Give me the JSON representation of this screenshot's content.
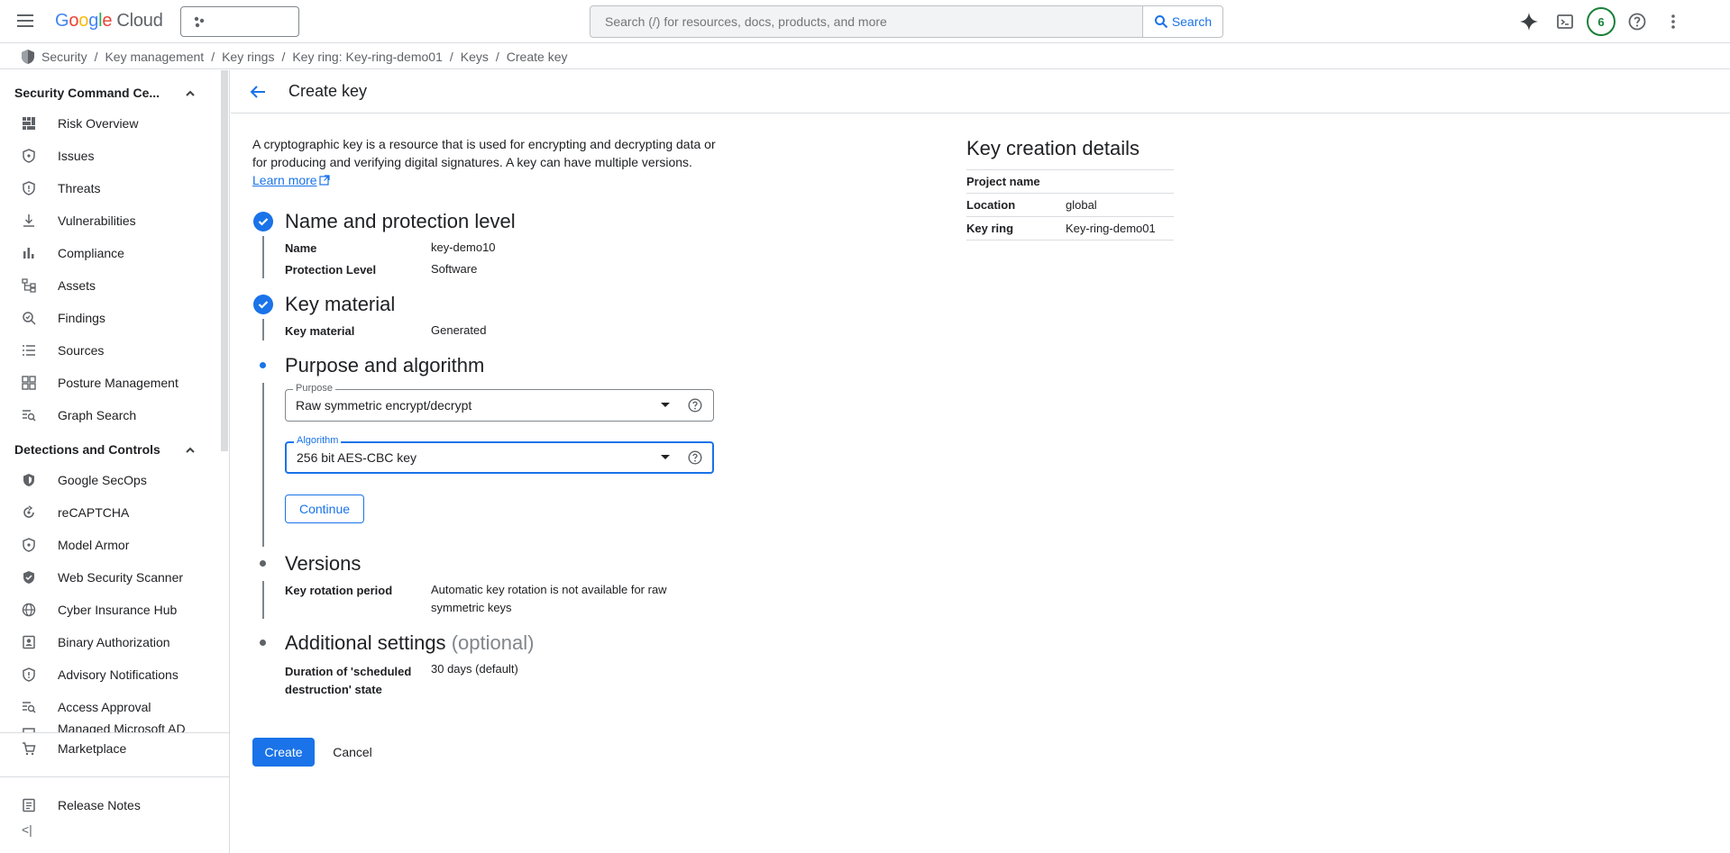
{
  "topbar": {
    "logo_letters": [
      "G",
      "o",
      "o",
      "g",
      "l",
      "e"
    ],
    "logo_cloud": "Cloud",
    "search_placeholder": "Search (/) for resources, docs, products, and more",
    "search_button": "Search",
    "notification_count": "6",
    "icons": [
      "menu-icon",
      "gemini-spark-icon",
      "cloud-shell-icon",
      "help-icon",
      "more-vert-icon"
    ]
  },
  "breadcrumb": [
    "Security",
    "Key management",
    "Key rings",
    "Key ring: Key-ring-demo01",
    "Keys",
    "Create key"
  ],
  "sidebar": {
    "section1": "Security Command Ce...",
    "section1_items": [
      {
        "label": "Risk Overview",
        "icon": "dashboard-icon"
      },
      {
        "label": "Issues",
        "icon": "shield-icon"
      },
      {
        "label": "Threats",
        "icon": "shield-icon"
      },
      {
        "label": "Vulnerabilities",
        "icon": "download-icon"
      },
      {
        "label": "Compliance",
        "icon": "bar-chart-icon"
      },
      {
        "label": "Assets",
        "icon": "hierarchy-icon"
      },
      {
        "label": "Findings",
        "icon": "search-shield-icon"
      },
      {
        "label": "Sources",
        "icon": "list-icon"
      },
      {
        "label": "Posture Management",
        "icon": "grid-icon"
      },
      {
        "label": "Graph Search",
        "icon": "search-list-icon"
      }
    ],
    "section2": "Detections and Controls",
    "section2_items": [
      {
        "label": "Google SecOps",
        "icon": "secops-icon"
      },
      {
        "label": "reCAPTCHA",
        "icon": "recaptcha-icon"
      },
      {
        "label": "Model Armor",
        "icon": "shield-icon"
      },
      {
        "label": "Web Security Scanner",
        "icon": "web-shield-icon"
      },
      {
        "label": "Cyber Insurance Hub",
        "icon": "globe-icon"
      },
      {
        "label": "Binary Authorization",
        "icon": "id-badge-icon"
      },
      {
        "label": "Advisory Notifications",
        "icon": "shield-icon"
      },
      {
        "label": "Access Approval",
        "icon": "search-list-icon"
      },
      {
        "label": "Managed Microsoft AD",
        "icon": "ad-icon"
      }
    ],
    "bottom_items": [
      {
        "label": "Marketplace",
        "icon": "cart-icon"
      },
      {
        "label": "Release Notes",
        "icon": "notes-icon"
      }
    ],
    "collapse": "<|"
  },
  "page": {
    "title": "Create key",
    "intro": "A cryptographic key is a resource that is used for encrypting and decrypting data or for producing and verifying digital signatures. A key can have multiple versions.",
    "learn_more": "Learn more",
    "steps": {
      "s1": {
        "title": "Name and protection level",
        "rows": [
          {
            "k": "Name",
            "v": "key-demo10"
          },
          {
            "k": "Protection Level",
            "v": "Software"
          }
        ]
      },
      "s2": {
        "title": "Key material",
        "rows": [
          {
            "k": "Key material",
            "v": "Generated"
          }
        ]
      },
      "s3": {
        "title": "Purpose and algorithm",
        "purpose_label": "Purpose",
        "purpose_value": "Raw symmetric encrypt/decrypt",
        "algorithm_label": "Algorithm",
        "algorithm_value": "256 bit AES-CBC key",
        "continue": "Continue"
      },
      "s4": {
        "title": "Versions",
        "rows": [
          {
            "k": "Key rotation period",
            "v": "Automatic key rotation is not available for raw symmetric keys"
          }
        ]
      },
      "s5": {
        "title": "Additional settings",
        "optional": "(optional)",
        "rows": [
          {
            "k": "Duration of 'scheduled destruction' state",
            "v": "30 days (default)"
          }
        ]
      }
    },
    "create": "Create",
    "cancel": "Cancel"
  },
  "details": {
    "title": "Key creation details",
    "rows": [
      {
        "k": "Project name",
        "v": ""
      },
      {
        "k": "Location",
        "v": "global"
      },
      {
        "k": "Key ring",
        "v": "Key-ring-demo01"
      }
    ]
  },
  "colors": {
    "accent": "#1a73e8",
    "badge": "#188038"
  }
}
